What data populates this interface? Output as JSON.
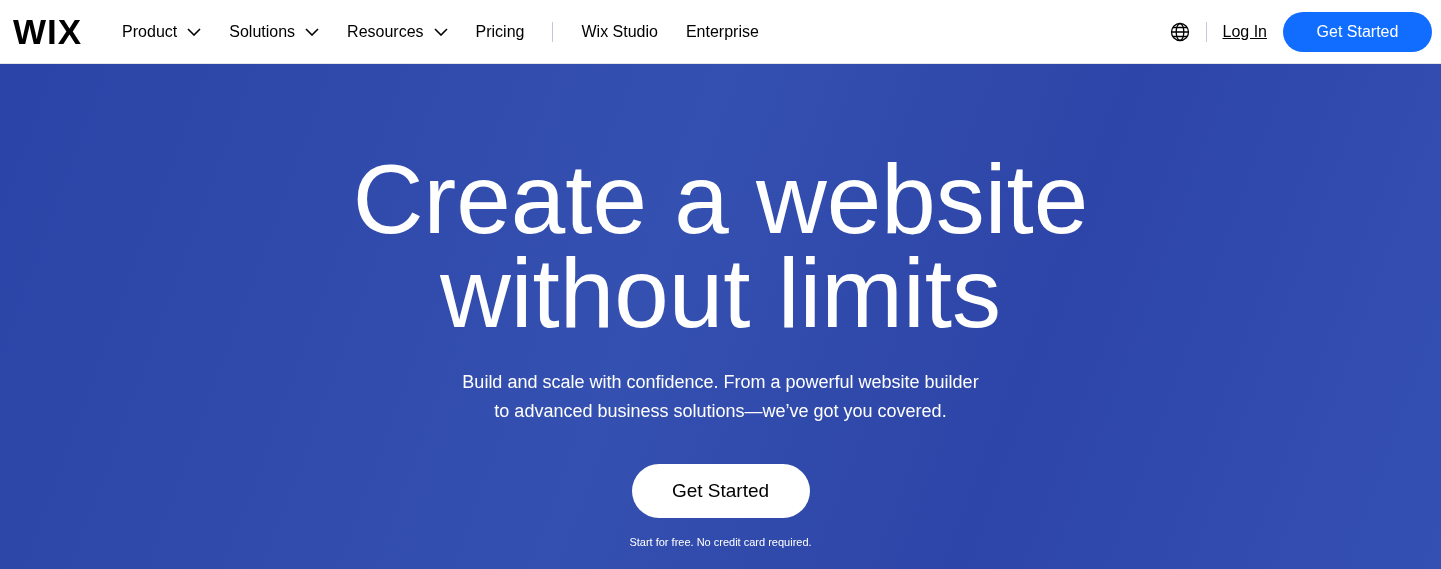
{
  "header": {
    "logo": "WIX",
    "nav": [
      {
        "label": "Product",
        "has_menu": true
      },
      {
        "label": "Solutions",
        "has_menu": true
      },
      {
        "label": "Resources",
        "has_menu": true
      },
      {
        "label": "Pricing",
        "has_menu": false
      }
    ],
    "nav_secondary": [
      {
        "label": "Wix Studio"
      },
      {
        "label": "Enterprise"
      }
    ],
    "login": "Log In",
    "cta": "Get Started"
  },
  "hero": {
    "headline": [
      "Create a website",
      "without limits"
    ],
    "subtitle": [
      "Build and scale with confidence. From a powerful website builder",
      "to advanced business solutions—we’ve got you covered."
    ],
    "cta": "Get Started",
    "note": "Start for free. No credit card required."
  }
}
